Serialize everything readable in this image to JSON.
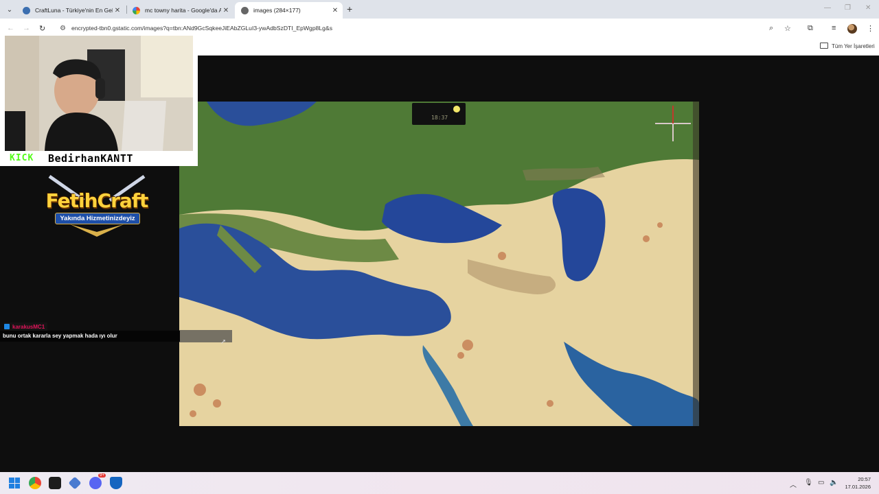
{
  "browser": {
    "tabs": [
      {
        "title": "CraftLuna - Türkiye'nin En Geliş",
        "active": false,
        "favicon": "globe-icon"
      },
      {
        "title": "mc towny harita - Google'da Ar",
        "active": false,
        "favicon": "google-icon"
      },
      {
        "title": "images (284×177)",
        "active": true,
        "favicon": "globe-icon"
      }
    ],
    "url": "encrypted-tbn0.gstatic.com/images?q=tbn:ANd9GcSqkeeJiEAbZGLuI3-ywAdbSzDTI_EpWgp8Lg&s",
    "bookmarks_folder": "Tüm Yer İşaretleri"
  },
  "stream": {
    "platform": "KICK",
    "streamer": "BedirhanKANTT",
    "logo_title": "FetihCraft",
    "logo_subtitle": "Yakında Hizmetinizdeyiz",
    "chat": {
      "username": "karakusMC1",
      "message": "bunu ortak kararla sey yapmak hada ıyı olur"
    }
  },
  "map": {
    "clock_text": "18:37"
  },
  "taskbar": {
    "time": "20:57",
    "date": "17.01.2026",
    "discord_badge": "9+"
  },
  "colors": {
    "kick_green": "#53fc18",
    "chat_user": "#e0145a",
    "sea": "#2a4f9a",
    "land_green": "#4f7a36",
    "desert": "#e6d3a0"
  }
}
